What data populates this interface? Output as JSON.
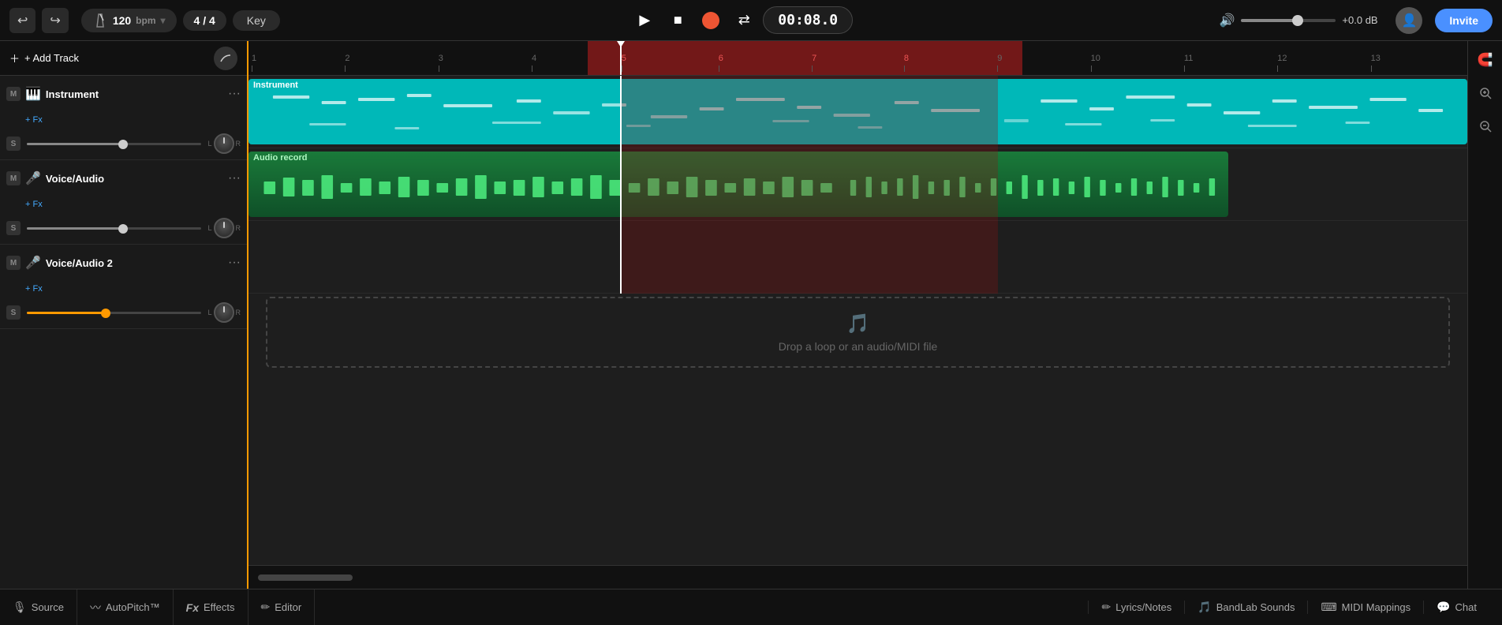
{
  "topbar": {
    "undo_label": "↩",
    "redo_label": "↪",
    "tempo": "120",
    "tempo_unit": "bpm",
    "time_sig": "4 / 4",
    "key_label": "Key",
    "play_label": "▶",
    "stop_label": "■",
    "loop_label": "⇄",
    "time_display": "00:08.0",
    "db_display": "+0.0 dB",
    "invite_label": "Invite"
  },
  "track_panel": {
    "add_track_label": "+ Add Track",
    "tracks": [
      {
        "id": "instrument",
        "name": "Instrument",
        "fx_label": "+ Fx",
        "icon": "🎹",
        "color": "#00c0c0",
        "m_btn": "M",
        "s_btn": "S",
        "slider_pct": 55,
        "type": "instrument"
      },
      {
        "id": "voice-audio",
        "name": "Voice/Audio",
        "fx_label": "+ Fx",
        "icon": "🎤",
        "color": "#4af",
        "m_btn": "M",
        "s_btn": "S",
        "slider_pct": 55,
        "type": "audio"
      },
      {
        "id": "voice-audio-2",
        "name": "Voice/Audio 2",
        "fx_label": "+ Fx",
        "icon": "🎤",
        "color": "#f90",
        "m_btn": "M",
        "s_btn": "S",
        "slider_pct": 45,
        "type": "audio2"
      }
    ]
  },
  "timeline": {
    "ruler_marks": [
      1,
      2,
      3,
      4,
      5,
      6,
      7,
      8,
      9,
      10,
      11,
      12,
      13
    ],
    "playhead_pct": 30.5,
    "selection_start_pct": 27.8,
    "selection_end_pct": 63.5,
    "drop_zone_text": "Drop a loop or an audio/MIDI file",
    "drop_zone_icon": "🎵"
  },
  "clips": {
    "instrument": {
      "label": "Instrument",
      "start_pct": 0,
      "width_pct": 100
    },
    "audio_1": {
      "label": "Audio record",
      "start_pct": 0,
      "width_pct": 63
    },
    "audio_2": {
      "label": "Audio record",
      "start_pct": 30.5,
      "width_pct": 32.5
    }
  },
  "bottom_bar": {
    "items": [
      {
        "label": "Source",
        "icon": "🎙"
      },
      {
        "label": "AutoPitch™",
        "icon": "〰"
      },
      {
        "label": "Effects",
        "icon": "Fx"
      },
      {
        "label": "Editor",
        "icon": "✏"
      }
    ],
    "right_items": [
      {
        "label": "Lyrics/Notes",
        "icon": "✏"
      },
      {
        "label": "BandLab Sounds",
        "icon": "🎵"
      },
      {
        "label": "MIDI Mappings",
        "icon": "⌨"
      },
      {
        "label": "Chat",
        "icon": "💬"
      }
    ]
  }
}
